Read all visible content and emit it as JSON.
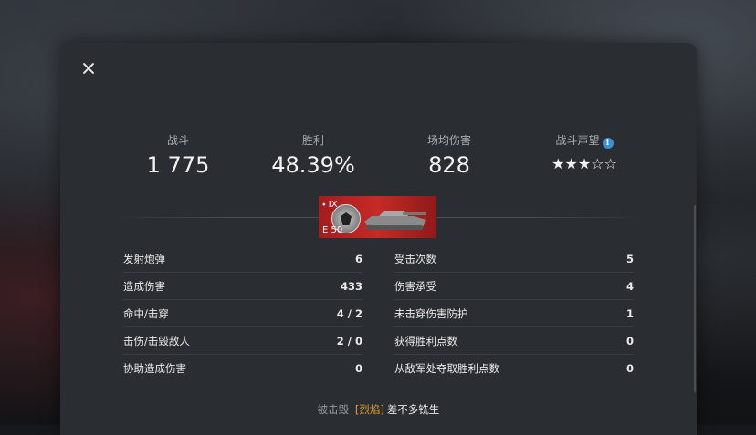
{
  "summary": {
    "battles_label": "战斗",
    "battles_value": "1 775",
    "winrate_label": "胜利",
    "winrate_value": "48.39%",
    "avg_damage_label": "场均伤害",
    "avg_damage_value": "828",
    "reputation_label": "战斗声望",
    "reputation_stars": "★★★☆☆",
    "reputation_rating": 3,
    "reputation_max": 5,
    "info_glyph": "i"
  },
  "tank": {
    "tier": "IX",
    "name": "E 50",
    "card_color": "#c52a26"
  },
  "stats_left": [
    {
      "label": "发射炮弹",
      "value": "6"
    },
    {
      "label": "造成伤害",
      "value": "433"
    },
    {
      "label": "命中/击穿",
      "value": "4 / 2"
    },
    {
      "label": "击伤/击毁敌人",
      "value": "2 / 0"
    },
    {
      "label": "协助造成伤害",
      "value": "0"
    }
  ],
  "stats_right": [
    {
      "label": "受击次数",
      "value": "5"
    },
    {
      "label": "伤害承受",
      "value": "4"
    },
    {
      "label": "未击穿伤害防护",
      "value": "1"
    },
    {
      "label": "获得胜利点数",
      "value": "0"
    },
    {
      "label": "从敌军处夺取胜利点数",
      "value": "0"
    }
  ],
  "footer": {
    "destroyed_label": "被击毁",
    "clan_tag": "[烈焰]",
    "player_name": "差不多铣生",
    "clan_color": "#e0a030"
  },
  "colors": {
    "modal_bg": "#2a2d31",
    "info_blue": "#3b8fd6"
  }
}
